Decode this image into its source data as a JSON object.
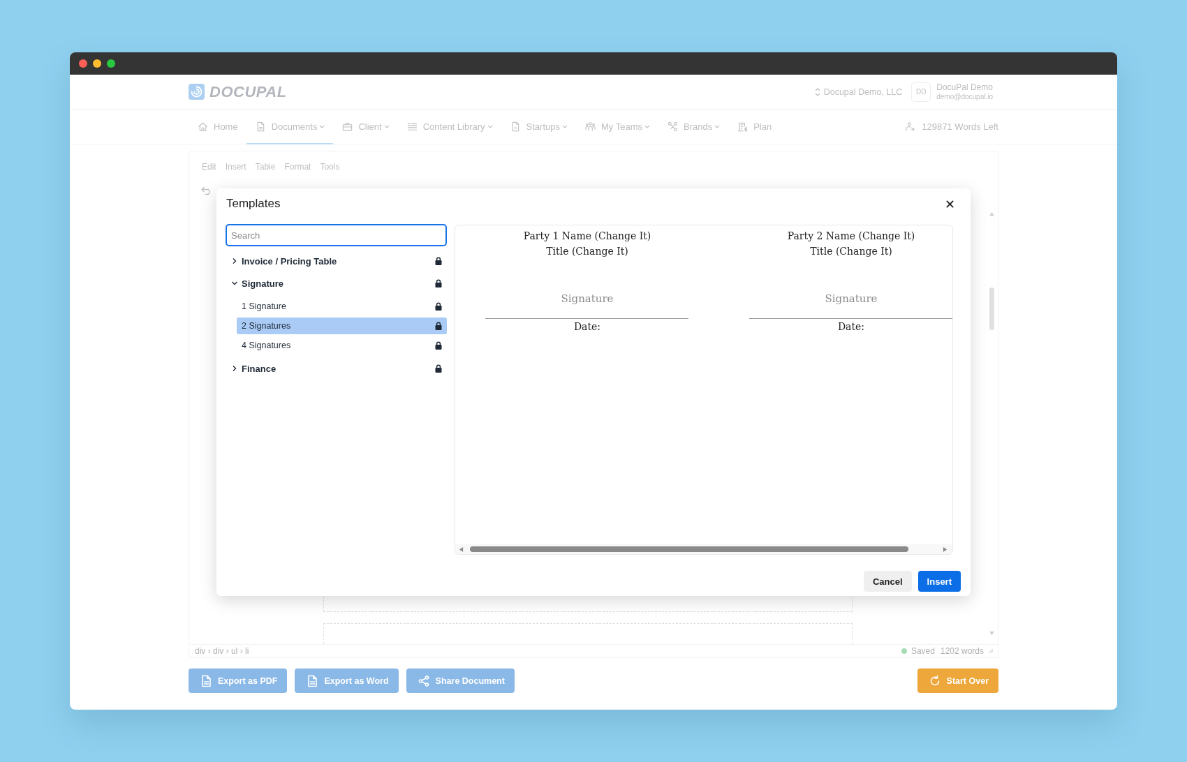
{
  "header": {
    "logo": "DOCUPAL",
    "organization": "Docupal Demo, LLC",
    "user": {
      "initials": "DD",
      "name": "DocuPal Demo",
      "email": "demo@docupal.io"
    }
  },
  "nav": {
    "items": [
      {
        "label": "Home",
        "selected": false,
        "dropdown": false
      },
      {
        "label": "Documents",
        "selected": true,
        "dropdown": true
      },
      {
        "label": "Client",
        "selected": false,
        "dropdown": true
      },
      {
        "label": "Content Library",
        "selected": false,
        "dropdown": true
      },
      {
        "label": "Startups",
        "selected": false,
        "dropdown": true
      },
      {
        "label": "My Teams",
        "selected": false,
        "dropdown": true
      },
      {
        "label": "Brands",
        "selected": false,
        "dropdown": true
      },
      {
        "label": "Plan",
        "selected": false,
        "dropdown": false
      }
    ],
    "words_left": "129871 Words Left"
  },
  "editor": {
    "menu": [
      "Edit",
      "Insert",
      "Table",
      "Format",
      "Tools"
    ],
    "path": "div › div › ul › li",
    "status": "Saved",
    "word_count": "1202 words"
  },
  "actions": [
    {
      "label": "Export as PDF",
      "kind": "primary"
    },
    {
      "label": "Export as Word",
      "kind": "primary"
    },
    {
      "label": "Share Document",
      "kind": "primary"
    },
    {
      "label": "Start Over",
      "kind": "warning"
    }
  ],
  "dialog": {
    "title": "Templates",
    "search": {
      "placeholder": "Search"
    },
    "tree": [
      {
        "label": "Invoice / Pricing Table",
        "expanded": false,
        "selected": false,
        "locked": true
      },
      {
        "label": "Signature",
        "expanded": true,
        "selected": false,
        "locked": true,
        "children": [
          {
            "label": "1 Signature",
            "selected": false,
            "locked": true
          },
          {
            "label": "2 Signatures",
            "selected": true,
            "locked": true
          },
          {
            "label": "4 Signatures",
            "selected": false,
            "locked": true
          }
        ]
      },
      {
        "label": "Finance",
        "expanded": false,
        "selected": false,
        "locked": true
      }
    ],
    "preview": {
      "parties": [
        {
          "name": "Party 1 Name (Change It)",
          "title": "Title (Change It)",
          "signature": "Signature",
          "date": "Date:"
        },
        {
          "name": "Party 2 Name (Change It)",
          "title": "Title (Change It)",
          "signature": "Signature",
          "date": "Date:"
        }
      ]
    },
    "buttons": [
      {
        "label": "Cancel",
        "kind": "secondary"
      },
      {
        "label": "Insert",
        "kind": "primary"
      }
    ]
  }
}
